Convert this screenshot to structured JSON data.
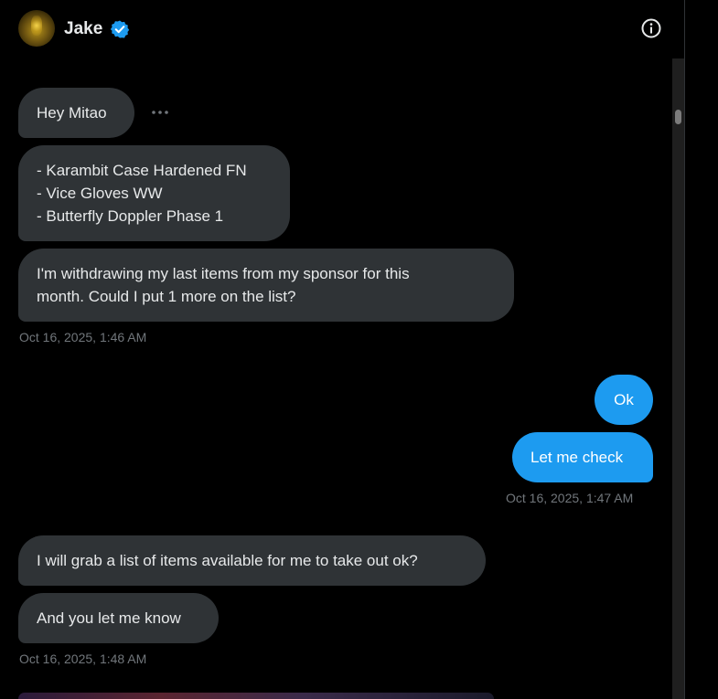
{
  "header": {
    "name": "Jake",
    "verified": true,
    "info_icon": "info-icon",
    "verified_icon": "verified-badge-icon"
  },
  "theme": {
    "incoming_bubble": "#2f3336",
    "outgoing_bubble": "#1d9bf0",
    "timestamp": "#71767b",
    "background": "#000000"
  },
  "messages": [
    {
      "direction": "in",
      "text": "Hey Mitao"
    },
    {
      "direction": "in",
      "text": "- Karambit Case Hardened FN\n- Vice Gloves WW\n- Butterfly Doppler Phase 1"
    },
    {
      "direction": "in",
      "text": "I'm withdrawing my last items from my sponsor for this\nmonth. Could I put 1 more on the list?"
    },
    {
      "direction": "out",
      "text": "Ok"
    },
    {
      "direction": "out",
      "text": "Let me check"
    },
    {
      "direction": "in",
      "text": "I will grab a list of items available for me to take out ok?"
    },
    {
      "direction": "in",
      "text": "And you let me know"
    }
  ],
  "timestamps": [
    "Oct 16, 2025, 1:46 AM",
    "Oct 16, 2025, 1:47 AM",
    "Oct 16, 2025, 1:48 AM"
  ],
  "more_options_icon": "more-horizontal-icon"
}
